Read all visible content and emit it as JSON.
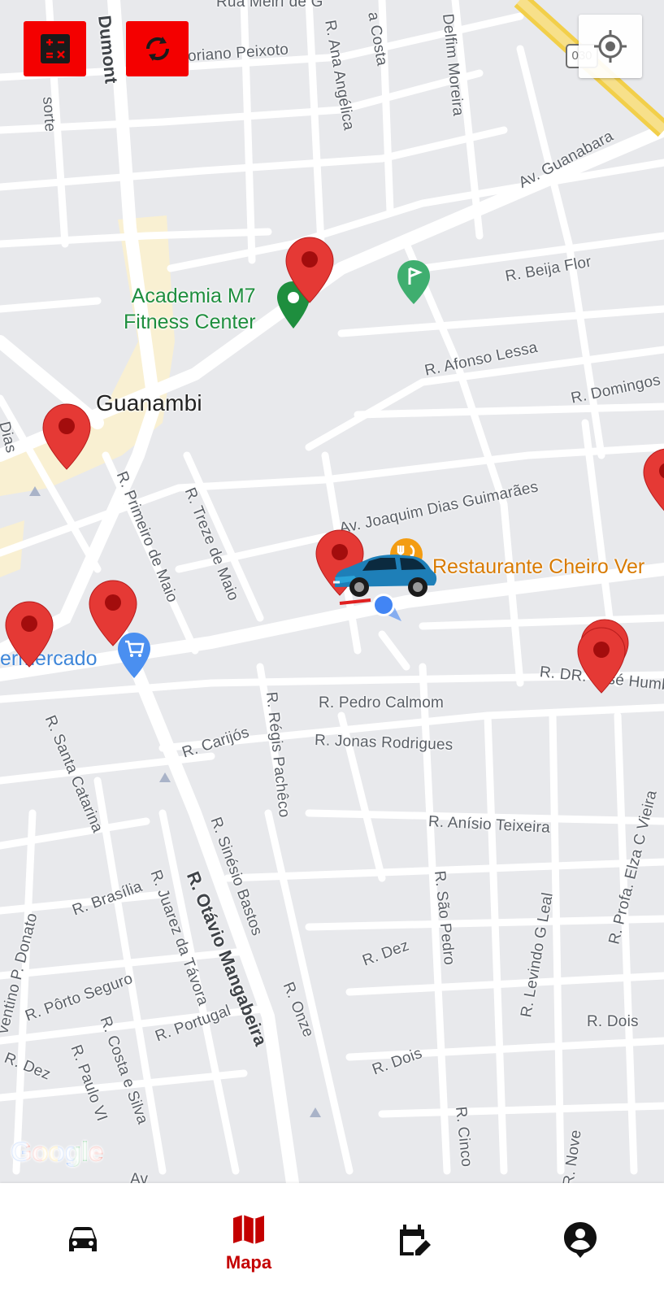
{
  "map": {
    "city_label": "Guanambi",
    "streets": [
      "Rua Meirı de G",
      "R. Floriano Peixoto",
      "R. Ana Angélica",
      "Delfim Moreira",
      "a Costa",
      "Dumont",
      "Av. Guanabara",
      "R. Beija Flor",
      "R. Afonso Lessa",
      "R. Domingos",
      "Av. Joaquim Dias Guimarães",
      "R. Primeiro de Maio",
      "R. Treze de Maio",
      "R. DR. José Humb",
      "R. Pedro Calmom",
      "R. Jonas Rodrigues",
      "R. Carijós",
      "R. Régis Pachêco",
      "R. Santa Catarina",
      "R. Anísio Teixeira",
      "R. Sinésio Bastos",
      "R. Otávio Mangabeira",
      "R. Juarez da Távora",
      "R. Brasília",
      "R. São Pedro",
      "R. Levindo G Leal",
      "R. Profa. Elza C Vieira",
      "R. Dez",
      "R. Pôrto Seguro",
      "R. Costa e Silva",
      "R. Portugal",
      "R. Onze",
      "R. Dois",
      "R. Dois",
      "R. Paulo VI",
      "R. Dez",
      "R. Cinco",
      "R. Nove",
      "ventino P. Donato",
      "Dias",
      "sorte",
      "Av"
    ],
    "pois": {
      "gym": "Academia M7\nFitness Center",
      "restaurant": "Restaurante Cheiro Ver",
      "supermarket": "ermercado"
    },
    "route_badge": "030",
    "logo": "Google"
  },
  "colors": {
    "marker_red": "#e53935",
    "marker_dot": "#a30d0d",
    "control_red": "#f40000",
    "accent_red": "#c40000",
    "poi_green": "#1e8e3e",
    "poi_orange": "#d87a00",
    "poi_blue": "#4a8ff0",
    "location_blue": "#4285f4"
  },
  "controls": {
    "calculator": "calculator-icon",
    "refresh": "refresh-icon",
    "locate": "crosshair-icon"
  },
  "nav": {
    "items": [
      {
        "icon": "car-icon",
        "label": ""
      },
      {
        "icon": "map-icon",
        "label": "Mapa"
      },
      {
        "icon": "calendar-edit-icon",
        "label": ""
      },
      {
        "icon": "account-pin-icon",
        "label": ""
      }
    ],
    "active_index": 1
  }
}
